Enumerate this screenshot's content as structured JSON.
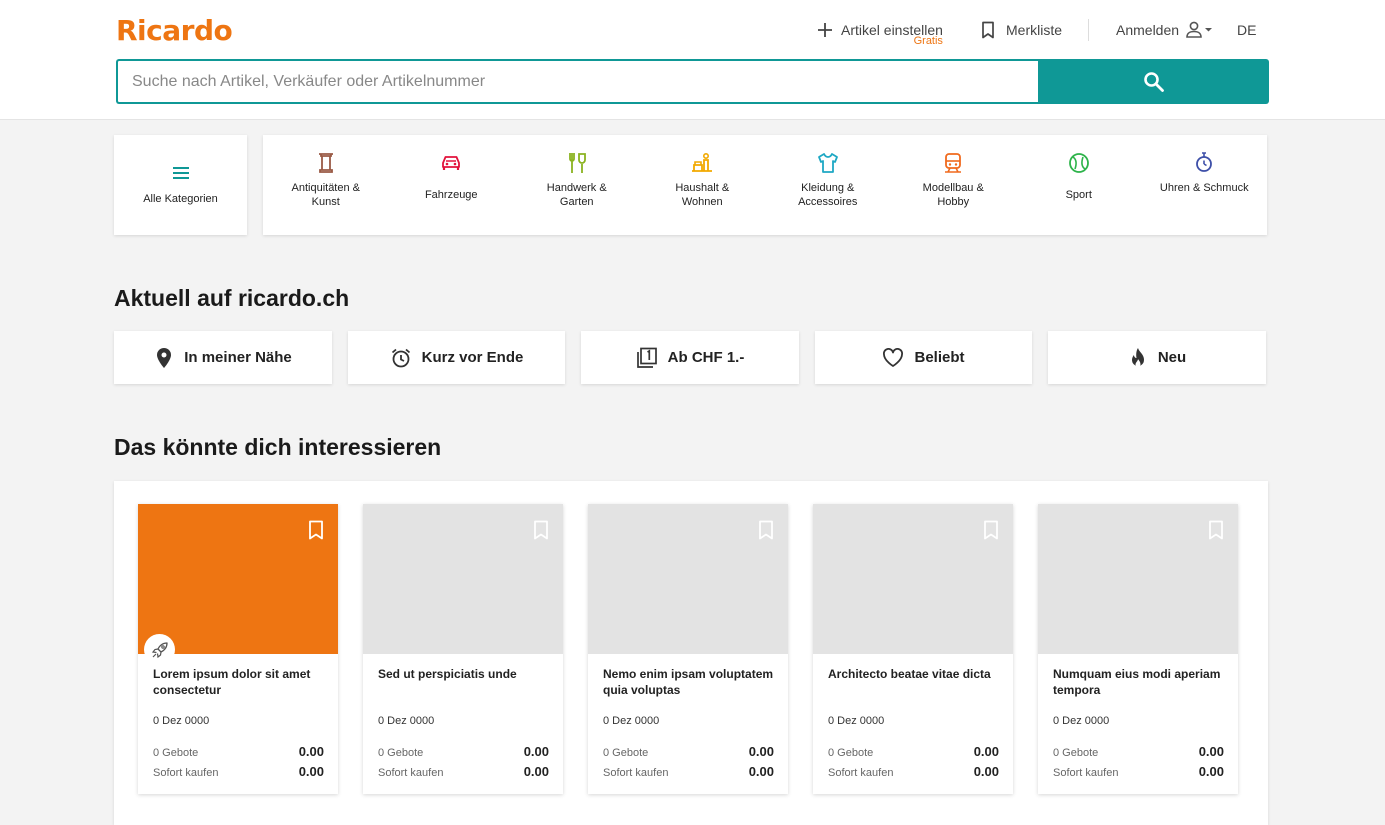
{
  "header": {
    "logo": "Ricardo",
    "sell_label": "Artikel einstellen",
    "sell_badge": "Gratis",
    "watchlist_label": "Merkliste",
    "login_label": "Anmelden",
    "language": "DE"
  },
  "search": {
    "placeholder": "Suche nach Artikel, Verkäufer oder Artikelnummer"
  },
  "categories": {
    "all_label": "Alle Kategorien",
    "items": [
      {
        "label": "Antiquitäten & Kunst",
        "icon": "column-icon",
        "color": "#9a5a45"
      },
      {
        "label": "Fahrzeuge",
        "icon": "car-icon",
        "color": "#e2123c"
      },
      {
        "label": "Handwerk & Garten",
        "icon": "tools-icon",
        "color": "#8bb320"
      },
      {
        "label": "Haushalt & Wohnen",
        "icon": "household-icon",
        "color": "#f2a900"
      },
      {
        "label": "Kleidung & Accessoires",
        "icon": "shirt-icon",
        "color": "#1ea8c4"
      },
      {
        "label": "Modellbau & Hobby",
        "icon": "train-icon",
        "color": "#f06a1d"
      },
      {
        "label": "Sport",
        "icon": "ball-icon",
        "color": "#2db34a"
      },
      {
        "label": "Uhren & Schmuck",
        "icon": "watch-icon",
        "color": "#3d4fa8"
      }
    ]
  },
  "current": {
    "heading": "Aktuell auf ricardo.ch",
    "filters": [
      {
        "label": "In meiner Nähe",
        "icon": "location-icon"
      },
      {
        "label": "Kurz vor Ende",
        "icon": "alarm-clock-icon"
      },
      {
        "label": "Ab CHF 1.-",
        "icon": "one-franc-icon"
      },
      {
        "label": "Beliebt",
        "icon": "heart-icon"
      },
      {
        "label": "Neu",
        "icon": "flame-icon"
      }
    ]
  },
  "interest": {
    "heading": "Das könnte dich interessieren",
    "products": [
      {
        "title": "Lorem ipsum dolor sit amet consectetur",
        "date": "0 Dez 0000",
        "bids_label": "0 Gebote",
        "bid_price": "0.00",
        "buy_label": "Sofort kaufen",
        "buy_price": "0.00"
      },
      {
        "title": "Sed ut perspiciatis unde",
        "date": "0 Dez 0000",
        "bids_label": "0 Gebote",
        "bid_price": "0.00",
        "buy_label": "Sofort kaufen",
        "buy_price": "0.00"
      },
      {
        "title": "Nemo enim ipsam voluptatem quia voluptas",
        "date": "0 Dez 0000",
        "bids_label": "0 Gebote",
        "bid_price": "0.00",
        "buy_label": "Sofort kaufen",
        "buy_price": "0.00"
      },
      {
        "title": "Architecto beatae vitae dicta",
        "date": "0 Dez 0000",
        "bids_label": "0 Gebote",
        "bid_price": "0.00",
        "buy_label": "Sofort kaufen",
        "buy_price": "0.00"
      },
      {
        "title": "Numquam eius modi aperiam tempora",
        "date": "0 Dez 0000",
        "bids_label": "0 Gebote",
        "bid_price": "0.00",
        "buy_label": "Sofort kaufen",
        "buy_price": "0.00"
      }
    ]
  },
  "colors": {
    "brand": "#ee7512",
    "accent": "#0f9896"
  }
}
